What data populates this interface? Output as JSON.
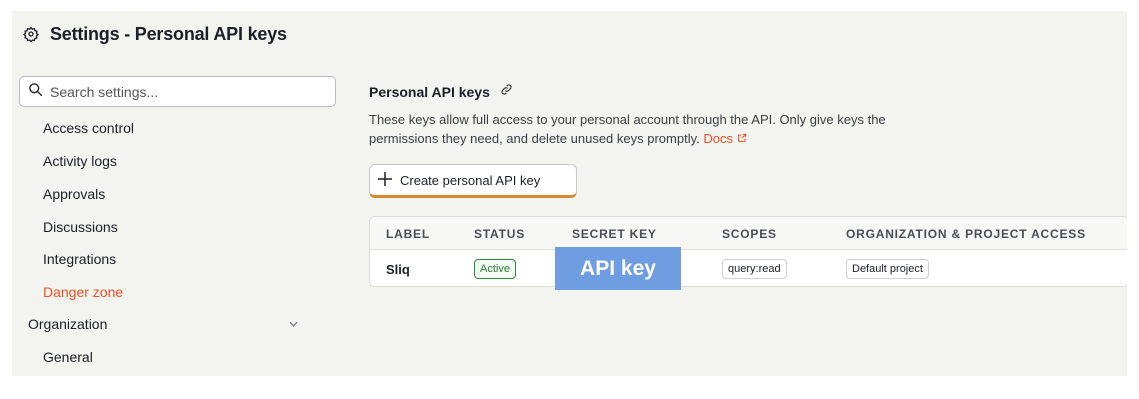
{
  "header": {
    "title": "Settings - Personal API keys",
    "icon": "gear-icon"
  },
  "search": {
    "placeholder": "Search settings..."
  },
  "sidebar": {
    "items": [
      {
        "label": "Access control"
      },
      {
        "label": "Activity logs"
      },
      {
        "label": "Approvals"
      },
      {
        "label": "Discussions"
      },
      {
        "label": "Integrations"
      },
      {
        "label": "Danger zone"
      }
    ],
    "group": {
      "label": "Organization",
      "icon": "chevron-down-icon"
    },
    "group_items": [
      {
        "label": "General"
      }
    ]
  },
  "main": {
    "title": "Personal API keys",
    "title_icon": "link-icon",
    "description_line1": "These keys allow full access to your personal account through the API. Only give keys the",
    "description_line2": "permissions they need, and delete unused keys promptly.",
    "docs_link": "Docs",
    "create_button": "Create personal API key",
    "table": {
      "columns": [
        "LABEL",
        "STATUS",
        "SECRET KEY",
        "SCOPES",
        "ORGANIZATION & PROJECT ACCESS"
      ],
      "rows": [
        {
          "label": "Sliq",
          "status": "Active",
          "secret_key": "API key",
          "scopes": "query:read",
          "access": "Default project"
        }
      ]
    }
  },
  "colors": {
    "danger": "#f04f21",
    "accent_border": "#d9882e",
    "active_green": "#2e8c3e",
    "key_mask": "#6f9de2"
  }
}
